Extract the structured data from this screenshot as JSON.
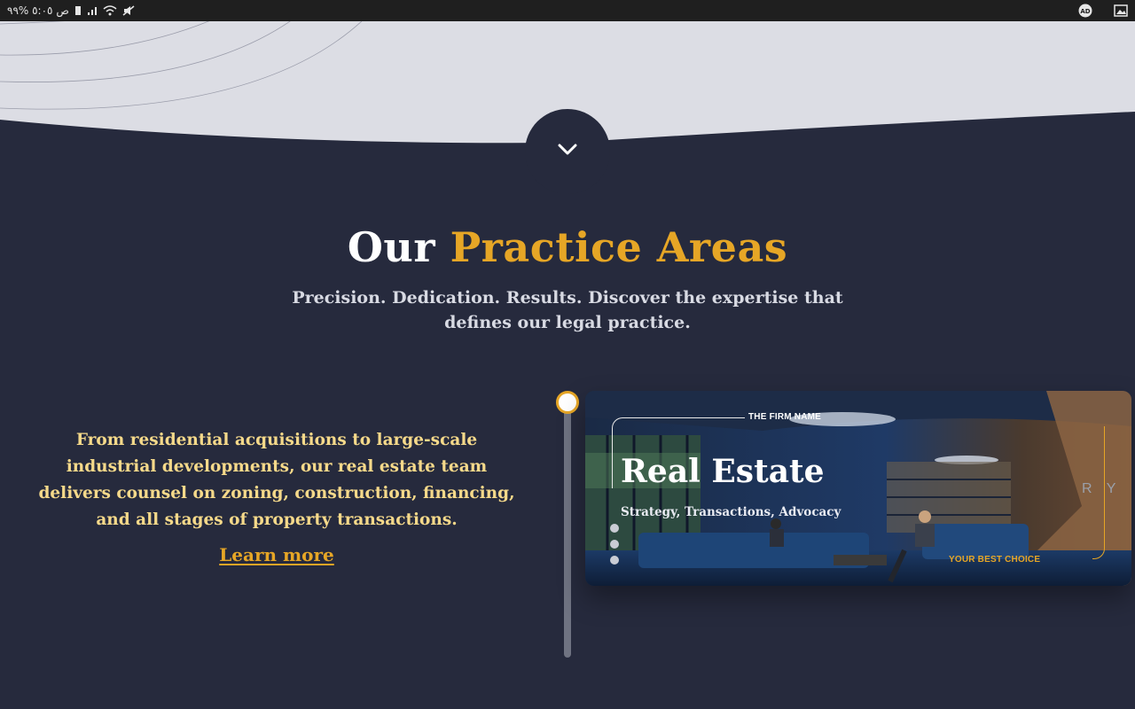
{
  "status_bar": {
    "left_text": "ص ٥:٠٥ %٩٩",
    "icons": [
      "battery-icon",
      "signal-icon",
      "wifi-icon",
      "mute-icon"
    ],
    "right_icons": [
      "ad-icon",
      "gallery-icon"
    ]
  },
  "section": {
    "title_part1": "Our ",
    "title_part2": "Practice Areas",
    "subtitle": "Precision. Dedication. Results. Discover the expertise that defines our legal practice."
  },
  "practice": {
    "description": "From residential acquisitions to large-scale industrial developments, our real estate team delivers counsel on zoning, construction, financing, and all stages of property transactions.",
    "learn_more": "Learn more"
  },
  "card": {
    "firm_name": "THE FIRM NAME",
    "title": "Real Estate",
    "subtitle": "Strategy, Transactions, Advocacy",
    "tagline": "YOUR BEST CHOICE",
    "wall_letters": "R Y"
  },
  "colors": {
    "background": "#262a3d",
    "accent": "#e6a626",
    "description_text": "#f5d98a",
    "band": "#dcdde4"
  }
}
